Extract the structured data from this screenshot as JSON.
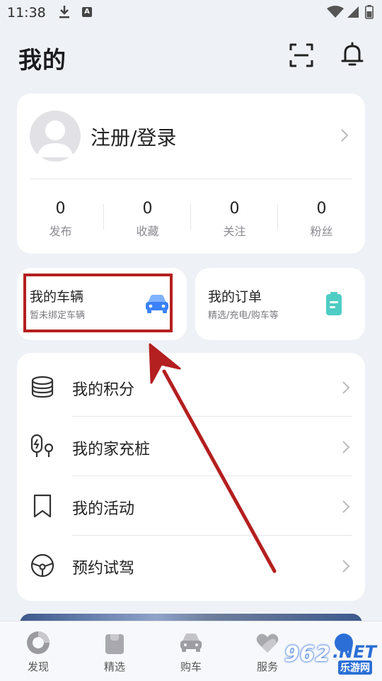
{
  "status_bar": {
    "time": "11:38",
    "a_badge": "A"
  },
  "header": {
    "title": "我的"
  },
  "profile": {
    "login_label": "注册/登录",
    "stats": [
      {
        "value": "0",
        "label": "发布"
      },
      {
        "value": "0",
        "label": "收藏"
      },
      {
        "value": "0",
        "label": "关注"
      },
      {
        "value": "0",
        "label": "粉丝"
      }
    ]
  },
  "vehicle_card": {
    "title": "我的车辆",
    "subtitle": "暂未绑定车辆"
  },
  "order_card": {
    "title": "我的订单",
    "subtitle": "精选/充电/购车等"
  },
  "menu": [
    {
      "label": "我的积分",
      "icon": "coins-stack-icon"
    },
    {
      "label": "我的家充桩",
      "icon": "charger-icon"
    },
    {
      "label": "我的活动",
      "icon": "bookmark-icon"
    },
    {
      "label": "预约试驾",
      "icon": "steering-wheel-icon"
    }
  ],
  "tabs": [
    {
      "label": "发现",
      "icon": "discover-icon"
    },
    {
      "label": "精选",
      "icon": "shopping-bag-icon"
    },
    {
      "label": "购车",
      "icon": "car-icon"
    },
    {
      "label": "服务",
      "icon": "heart-icon"
    },
    {
      "label": "",
      "icon": "profile-dot-icon"
    }
  ],
  "watermark": {
    "number": "962",
    "suffix": ".NET",
    "sub": "乐游网"
  },
  "colors": {
    "accent_red": "#b41f1f",
    "car_blue": "#3b82f6",
    "order_teal": "#4ecdc4",
    "brand_blue": "#2b6fd6"
  }
}
